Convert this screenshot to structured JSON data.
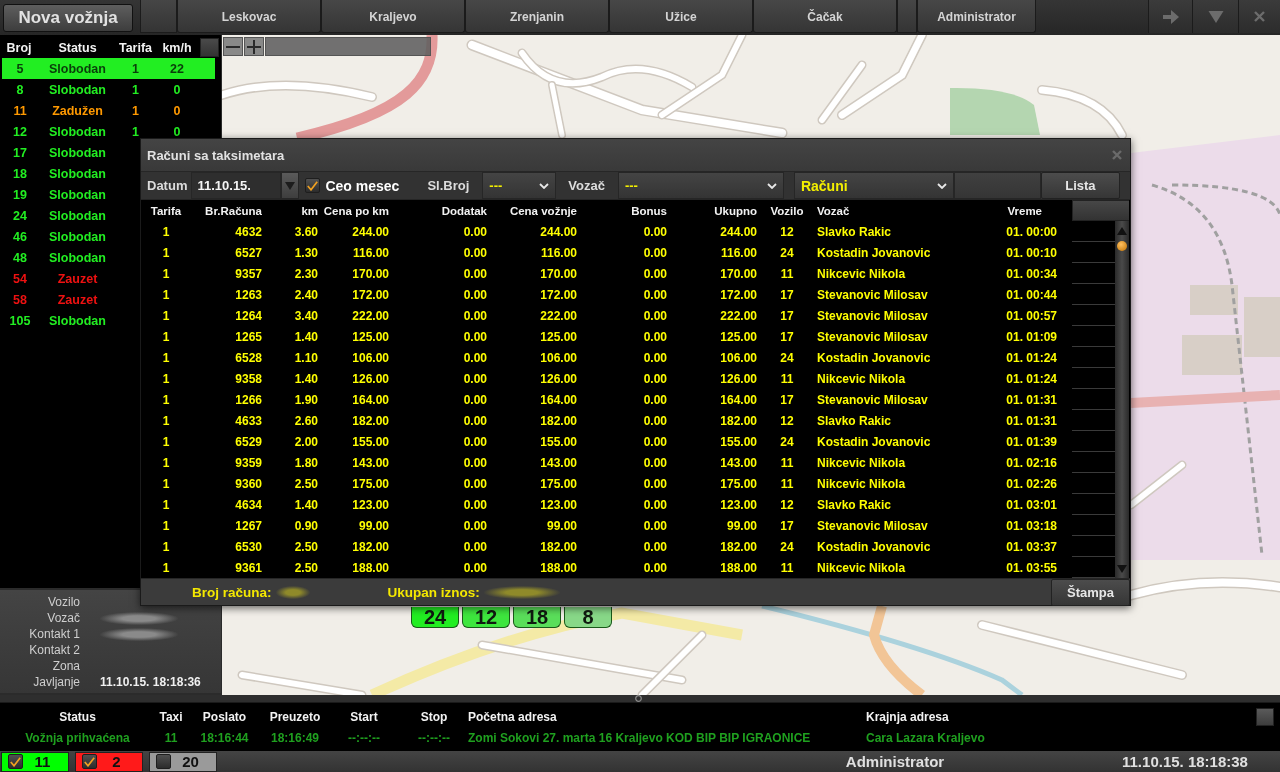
{
  "top_bar": {
    "new_ride_button": "Nova vožnja",
    "tabs": [
      {
        "label": "Leskovac",
        "selected": false
      },
      {
        "label": "Kraljevo",
        "selected": false
      },
      {
        "label": "Zrenjanin",
        "selected": false
      },
      {
        "label": "Užice",
        "selected": false
      },
      {
        "label": "Čačak",
        "selected": false
      }
    ],
    "user_tab": {
      "label": "Administrator",
      "selected": false
    }
  },
  "vehicles": {
    "columns": [
      "Broj",
      "Status",
      "Tarifa",
      "km/h"
    ],
    "rows": [
      {
        "number": "5",
        "status": "Slobodan",
        "tariff": "1",
        "speed": "22",
        "color": "#22ee22",
        "selected": true
      },
      {
        "number": "8",
        "status": "Slobodan",
        "tariff": "1",
        "speed": "0",
        "color": "#22ee22",
        "selected": false
      },
      {
        "number": "11",
        "status": "Zadužen",
        "tariff": "1",
        "speed": "0",
        "color": "#ff9900",
        "selected": false
      },
      {
        "number": "12",
        "status": "Slobodan",
        "tariff": "1",
        "speed": "0",
        "color": "#22ee22",
        "selected": false
      },
      {
        "number": "17",
        "status": "Slobodan",
        "color": "#22ee22",
        "selected": false
      },
      {
        "number": "18",
        "status": "Slobodan",
        "color": "#22ee22",
        "selected": false
      },
      {
        "number": "19",
        "status": "Slobodan",
        "color": "#22ee22",
        "selected": false
      },
      {
        "number": "24",
        "status": "Slobodan",
        "color": "#22ee22",
        "selected": false
      },
      {
        "number": "46",
        "status": "Slobodan",
        "color": "#22ee22",
        "selected": false
      },
      {
        "number": "48",
        "status": "Slobodan",
        "color": "#22ee22",
        "selected": false
      },
      {
        "number": "54",
        "status": "Zauzet",
        "color": "#ee1111",
        "selected": false
      },
      {
        "number": "58",
        "status": "Zauzet",
        "color": "#ee1111",
        "selected": false
      },
      {
        "number": "105",
        "status": "Slobodan",
        "color": "#22ee22",
        "selected": false
      }
    ]
  },
  "vehicle_info": {
    "fields": [
      {
        "label": "Vozilo"
      },
      {
        "label": "Vozač",
        "redacted": true
      },
      {
        "label": "Kontakt 1",
        "redacted": true
      },
      {
        "label": "Kontakt 2"
      },
      {
        "label": "Zona"
      },
      {
        "label": "Javljanje",
        "value": "11.10.15. 18:18:36"
      }
    ]
  },
  "map": {
    "markers": [
      {
        "label": "24",
        "color": "#22ee22"
      },
      {
        "label": "12",
        "color": "#3ee63e"
      },
      {
        "label": "18",
        "color": "#5ade5a"
      },
      {
        "label": "8",
        "color": "#88d888"
      }
    ]
  },
  "dialog": {
    "title": "Računi sa taksimetara",
    "filters": {
      "date_label": "Datum",
      "date_value": "11.10.15.",
      "whole_month": {
        "label": "Ceo mesec",
        "checked": true
      },
      "number_label": "Sl.Broj",
      "number_value": "---",
      "driver_label": "Vozač",
      "driver_value": "---",
      "type_value": "Računi",
      "list_button": "Lista"
    },
    "table": {
      "columns": [
        "Tarifa",
        "Br.Računa",
        "km",
        "Cena po km",
        "Dodatak",
        "Cena vožnje",
        "Bonus",
        "Ukupno",
        "Vozilo",
        "Vozač",
        "Vreme"
      ],
      "rows": [
        [
          "1",
          "4632",
          "3.60",
          "244.00",
          "0.00",
          "244.00",
          "0.00",
          "244.00",
          "12",
          "Slavko Rakic",
          "01. 00:00"
        ],
        [
          "1",
          "6527",
          "1.30",
          "116.00",
          "0.00",
          "116.00",
          "0.00",
          "116.00",
          "24",
          "Kostadin Jovanovic",
          "01. 00:10"
        ],
        [
          "1",
          "9357",
          "2.30",
          "170.00",
          "0.00",
          "170.00",
          "0.00",
          "170.00",
          "11",
          "Nikcevic Nikola",
          "01. 00:34"
        ],
        [
          "1",
          "1263",
          "2.40",
          "172.00",
          "0.00",
          "172.00",
          "0.00",
          "172.00",
          "17",
          "Stevanovic Milosav",
          "01. 00:44"
        ],
        [
          "1",
          "1264",
          "3.40",
          "222.00",
          "0.00",
          "222.00",
          "0.00",
          "222.00",
          "17",
          "Stevanovic Milosav",
          "01. 00:57"
        ],
        [
          "1",
          "1265",
          "1.40",
          "125.00",
          "0.00",
          "125.00",
          "0.00",
          "125.00",
          "17",
          "Stevanovic Milosav",
          "01. 01:09"
        ],
        [
          "1",
          "6528",
          "1.10",
          "106.00",
          "0.00",
          "106.00",
          "0.00",
          "106.00",
          "24",
          "Kostadin Jovanovic",
          "01. 01:24"
        ],
        [
          "1",
          "9358",
          "1.40",
          "126.00",
          "0.00",
          "126.00",
          "0.00",
          "126.00",
          "11",
          "Nikcevic Nikola",
          "01. 01:24"
        ],
        [
          "1",
          "1266",
          "1.90",
          "164.00",
          "0.00",
          "164.00",
          "0.00",
          "164.00",
          "17",
          "Stevanovic Milosav",
          "01. 01:31"
        ],
        [
          "1",
          "4633",
          "2.60",
          "182.00",
          "0.00",
          "182.00",
          "0.00",
          "182.00",
          "12",
          "Slavko Rakic",
          "01. 01:31"
        ],
        [
          "1",
          "6529",
          "2.00",
          "155.00",
          "0.00",
          "155.00",
          "0.00",
          "155.00",
          "24",
          "Kostadin Jovanovic",
          "01. 01:39"
        ],
        [
          "1",
          "9359",
          "1.80",
          "143.00",
          "0.00",
          "143.00",
          "0.00",
          "143.00",
          "11",
          "Nikcevic Nikola",
          "01. 02:16"
        ],
        [
          "1",
          "9360",
          "2.50",
          "175.00",
          "0.00",
          "175.00",
          "0.00",
          "175.00",
          "11",
          "Nikcevic Nikola",
          "01. 02:26"
        ],
        [
          "1",
          "4634",
          "1.40",
          "123.00",
          "0.00",
          "123.00",
          "0.00",
          "123.00",
          "12",
          "Slavko Rakic",
          "01. 03:01"
        ],
        [
          "1",
          "1267",
          "0.90",
          "99.00",
          "0.00",
          "99.00",
          "0.00",
          "99.00",
          "17",
          "Stevanovic Milosav",
          "01. 03:18"
        ],
        [
          "1",
          "6530",
          "2.50",
          "182.00",
          "0.00",
          "182.00",
          "0.00",
          "182.00",
          "24",
          "Kostadin Jovanovic",
          "01. 03:37"
        ],
        [
          "1",
          "9361",
          "2.50",
          "188.00",
          "0.00",
          "188.00",
          "0.00",
          "188.00",
          "11",
          "Nikcevic Nikola",
          "01. 03:55"
        ]
      ]
    },
    "footer": {
      "count_label": "Broj računa:",
      "count_redacted": true,
      "total_label": "Ukupan iznos:",
      "total_redacted": true,
      "print_button": "Štampa"
    }
  },
  "rides": {
    "columns": [
      "Status",
      "Taxi",
      "Poslato",
      "Preuzeto",
      "Start",
      "Stop",
      "Početna adresa",
      "Krajnja adresa"
    ],
    "rows": [
      [
        "Vožnja prihvaćena",
        "11",
        "18:16:44",
        "18:16:49",
        "--:--:--",
        "--:--:--",
        "Zomi Sokovi 27. marta 16 Kraljevo KOD BIP BIP IGRAONICE",
        "Cara Lazara Kraljevo"
      ]
    ]
  },
  "status_bar": {
    "filters": [
      {
        "count": "11",
        "checked": true,
        "color": "#00ff00"
      },
      {
        "count": "2",
        "checked": true,
        "color": "#ff1a1a"
      },
      {
        "count": "20",
        "checked": false,
        "color": "#9a9a9a"
      }
    ],
    "user": "Administrator",
    "datetime": "11.10.15. 18:18:38"
  }
}
